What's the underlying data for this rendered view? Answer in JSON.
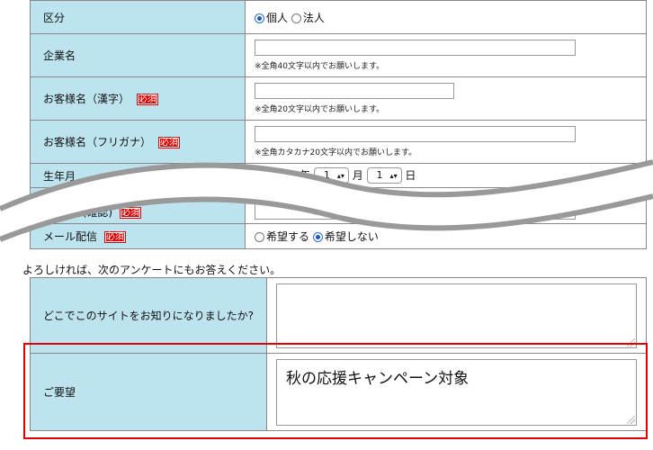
{
  "form": {
    "category_label": "区分",
    "category_options": [
      "個人",
      "法人"
    ],
    "category_selected": "個人",
    "company_label": "企業名",
    "company_note": "※全角40文字以内でお願いします。",
    "name_kanji_label": "お客様名（漢字）",
    "name_kanji_note": "※全角20文字以内でお願いします。",
    "name_kana_label": "お客様名（フリガナ）",
    "name_kana_note": "※全角カタカナ20文字以内でお願いします。",
    "birthdate_label": "生年月",
    "birth_year_unit": "年",
    "birth_month": "1",
    "birth_month_unit": "月",
    "birth_day": "1",
    "birth_day_unit": "日",
    "email_confirm_label": "mail(確認)",
    "mail_delivery_label": "メール配信",
    "mail_delivery_options": [
      "希望する",
      "希望しない"
    ],
    "mail_delivery_selected": "希望しない",
    "required_badge": "必須"
  },
  "survey": {
    "intro": "よろしければ、次のアンケートにもお答えください。",
    "source_question": "どこでこのサイトをお知りになりましたか?",
    "source_answer": "",
    "request_label": "ご要望",
    "request_value": "秋の応援キャンペーン対象"
  },
  "colors": {
    "label_bg": "#bde3ef",
    "required_bg": "#dd0000",
    "highlight": "#e00000",
    "radio_on": "#1d56b8"
  }
}
